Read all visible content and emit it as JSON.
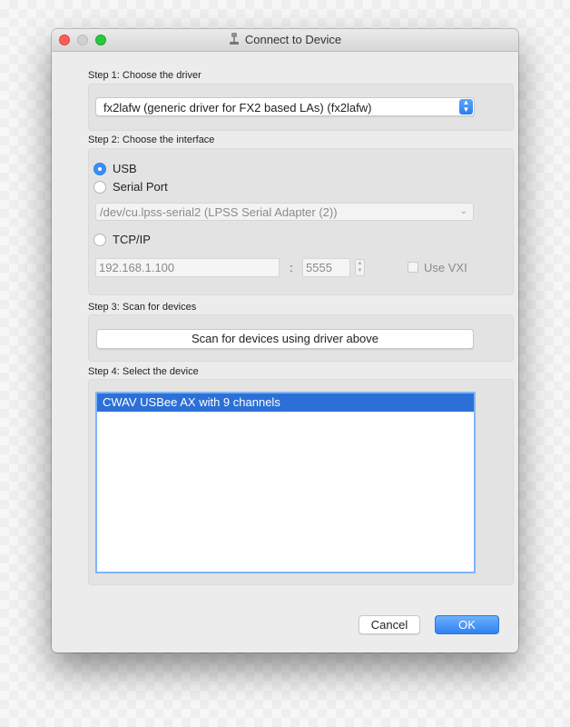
{
  "window": {
    "title": "Connect to Device"
  },
  "step1": {
    "label": "Step 1: Choose the driver",
    "driver_value": "fx2lafw (generic driver for FX2 based LAs) (fx2lafw)"
  },
  "step2": {
    "label": "Step 2: Choose the interface",
    "usb_label": "USB",
    "usb_selected": true,
    "serial_label": "Serial Port",
    "serial_port_value": "/dev/cu.lpss-serial2 (LPSS Serial Adapter (2))",
    "tcp_label": "TCP/IP",
    "host_value": "192.168.1.100",
    "separator": ":",
    "port_value": "5555",
    "vxi_label": "Use VXI"
  },
  "step3": {
    "label": "Step 3: Scan for devices",
    "scan_button": "Scan for devices using driver above"
  },
  "step4": {
    "label": "Step 4: Select the device",
    "devices": [
      "CWAV USBee AX with 9 channels"
    ]
  },
  "footer": {
    "cancel_label": "Cancel",
    "ok_label": "OK"
  },
  "colors": {
    "accent": "#2c6fd6",
    "close": "#ff5f57",
    "maximize": "#28c840"
  },
  "icons": [
    "app-icon",
    "chevron-down-icon",
    "stepper-icon"
  ]
}
